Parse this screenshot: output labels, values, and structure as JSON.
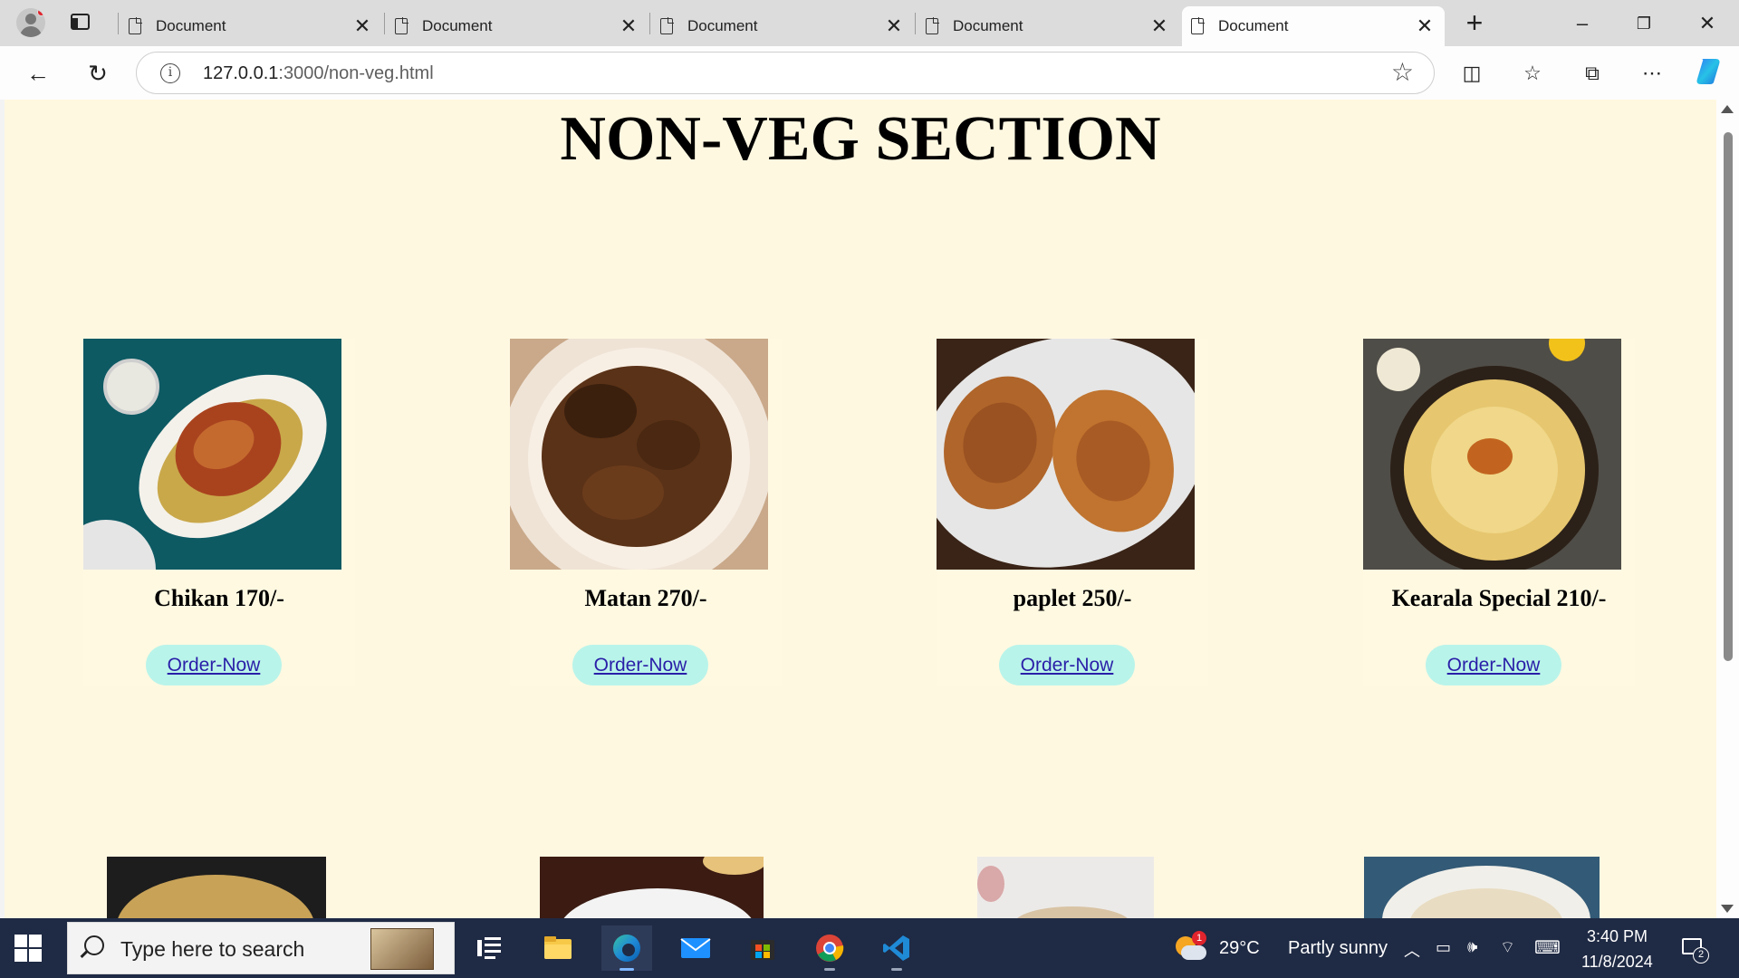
{
  "browser": {
    "tabs": [
      {
        "title": "Document",
        "active": false
      },
      {
        "title": "Document",
        "active": false
      },
      {
        "title": "Document",
        "active": false
      },
      {
        "title": "Document",
        "active": false
      },
      {
        "title": "Document",
        "active": true
      }
    ],
    "url_host": "127.0.0.1",
    "url_path": ":3000/non-veg.html"
  },
  "page": {
    "title": "NON-VEG SECTION",
    "items": [
      {
        "name": "Chikan 170/-",
        "button": "Order-Now"
      },
      {
        "name": "Matan 270/-",
        "button": "Order-Now"
      },
      {
        "name": "paplet 250/-",
        "button": "Order-Now"
      },
      {
        "name": "Kearala Special 210/-",
        "button": "Order-Now"
      }
    ]
  },
  "taskbar": {
    "search_placeholder": "Type here to search",
    "weather_temp": "29°C",
    "weather_desc": "Partly sunny",
    "weather_badge": "1",
    "time": "3:40 PM",
    "date": "11/8/2024",
    "notification_count": "2"
  }
}
